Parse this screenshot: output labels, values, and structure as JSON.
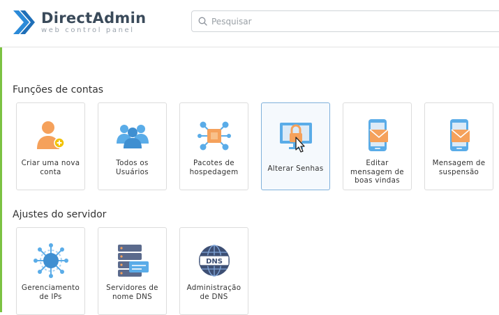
{
  "app": {
    "title": "DirectAdmin",
    "subtitle": "web control panel"
  },
  "search": {
    "placeholder": "Pesquisar",
    "value": ""
  },
  "colors": {
    "accent": "#7cc242",
    "brand": "#2b8ad8",
    "icon_orange": "#f5a15b",
    "icon_blue": "#5aace8"
  },
  "sections": [
    {
      "title": "Funções de contas",
      "cards": [
        {
          "label": "Criar uma nova conta",
          "icon": "add-user-icon"
        },
        {
          "label": "Todos os Usuários",
          "icon": "users-group-icon"
        },
        {
          "label": "Pacotes de hospedagem",
          "icon": "packages-icon"
        },
        {
          "label": "Alterar Senhas",
          "icon": "password-lock-icon",
          "active": true
        },
        {
          "label": "Editar mensagem de boas vindas",
          "icon": "welcome-message-icon"
        },
        {
          "label": "Mensagem de suspensão",
          "icon": "suspension-message-icon"
        }
      ]
    },
    {
      "title": "Ajustes do servidor",
      "cards": [
        {
          "label": "Gerenciamento de IPs",
          "icon": "ip-network-icon"
        },
        {
          "label": "Servidores de nome DNS",
          "icon": "nameserver-icon"
        },
        {
          "label": "Administração de DNS",
          "icon": "dns-globe-icon"
        }
      ]
    }
  ]
}
